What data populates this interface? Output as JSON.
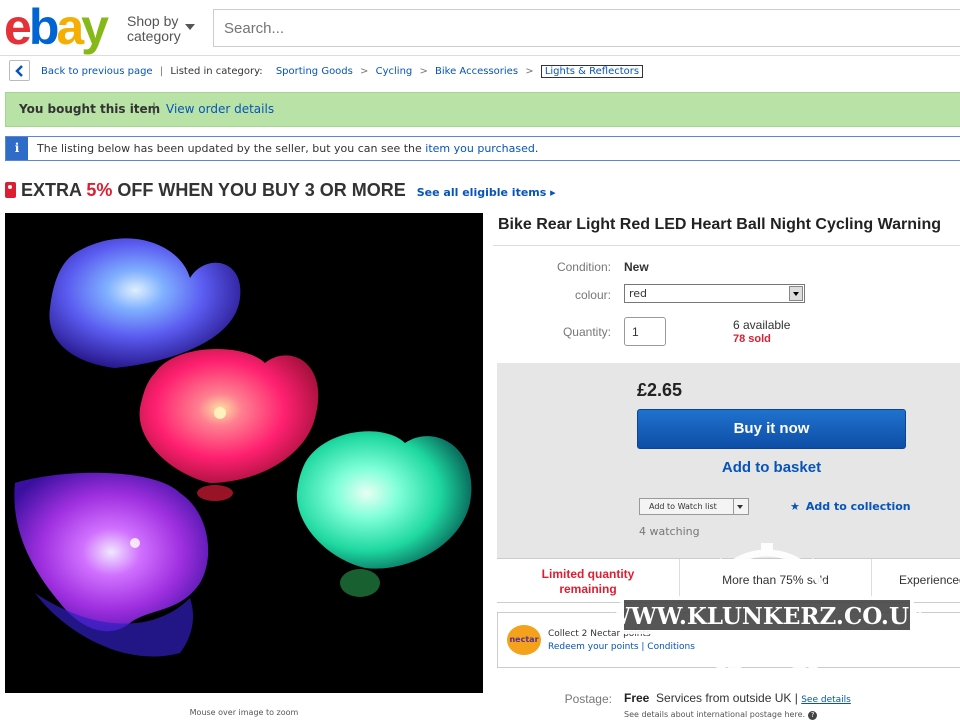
{
  "header": {
    "logo": {
      "e": "e",
      "b": "b",
      "a": "a",
      "y": "y"
    },
    "shop_by": {
      "line1": "Shop by",
      "line2": "category"
    },
    "search_placeholder": "Search..."
  },
  "breadcrumb": {
    "back": "Back to previous page",
    "listed_in": "Listed in category:",
    "items": [
      "Sporting Goods",
      "Cycling",
      "Bike Accessories",
      "Lights & Reflectors"
    ],
    "separator": ">"
  },
  "bought_bar": {
    "text": "You bought this item",
    "divider": "|",
    "link": "View order details"
  },
  "info_bar": {
    "icon": "i",
    "text": "The listing below has been updated by the seller, but you can see the",
    "link": "item you purchased",
    "tail": "."
  },
  "promo": {
    "pre": "EXTRA ",
    "pct": "5%",
    "post": " OFF WHEN YOU BUY 3 OR MORE",
    "link": "See all eligible items",
    "arrow": "▸"
  },
  "image_caption": "Mouse over image to zoom",
  "listing": {
    "title": "Bike Rear Light Red LED Heart Ball Night Cycling Warning",
    "condition_label": "Condition:",
    "condition_value": "New",
    "color_label": "colour:",
    "color_value": "red",
    "quantity_label": "Quantity:",
    "quantity_value": "1",
    "available": "6 available",
    "sold": "78 sold"
  },
  "buy_box": {
    "price": "£2.65",
    "buy_now": "Buy it now",
    "add_basket": "Add to basket",
    "watch_list": "Add to Watch list",
    "collection_star": "★",
    "add_collection": "Add to collection",
    "watching": "4 watching"
  },
  "highlights": {
    "limited_l1": "Limited quantity",
    "limited_l2": "remaining",
    "more_than": "More than 75% sold",
    "experience": "Experienced"
  },
  "nectar": {
    "logo": "nectar",
    "line1": "Collect 2 Nectar points",
    "line2": "Redeem your points | Conditions"
  },
  "postage": {
    "label": "Postage:",
    "value": "Free",
    "sub": "Services from outside UK |",
    "link": "See details",
    "note": "See details about international postage here.",
    "help": "?"
  },
  "watermark": "WWW.KLUNKERZ.CO.UK",
  "colors": {
    "ebay_red": "#e53238",
    "ebay_blue": "#0064d2",
    "ebay_yellow": "#f5af02",
    "ebay_green": "#86b817",
    "link_blue": "#0654ba",
    "promo_red": "#dd1e31",
    "bought_green": "#b9e3a6"
  }
}
